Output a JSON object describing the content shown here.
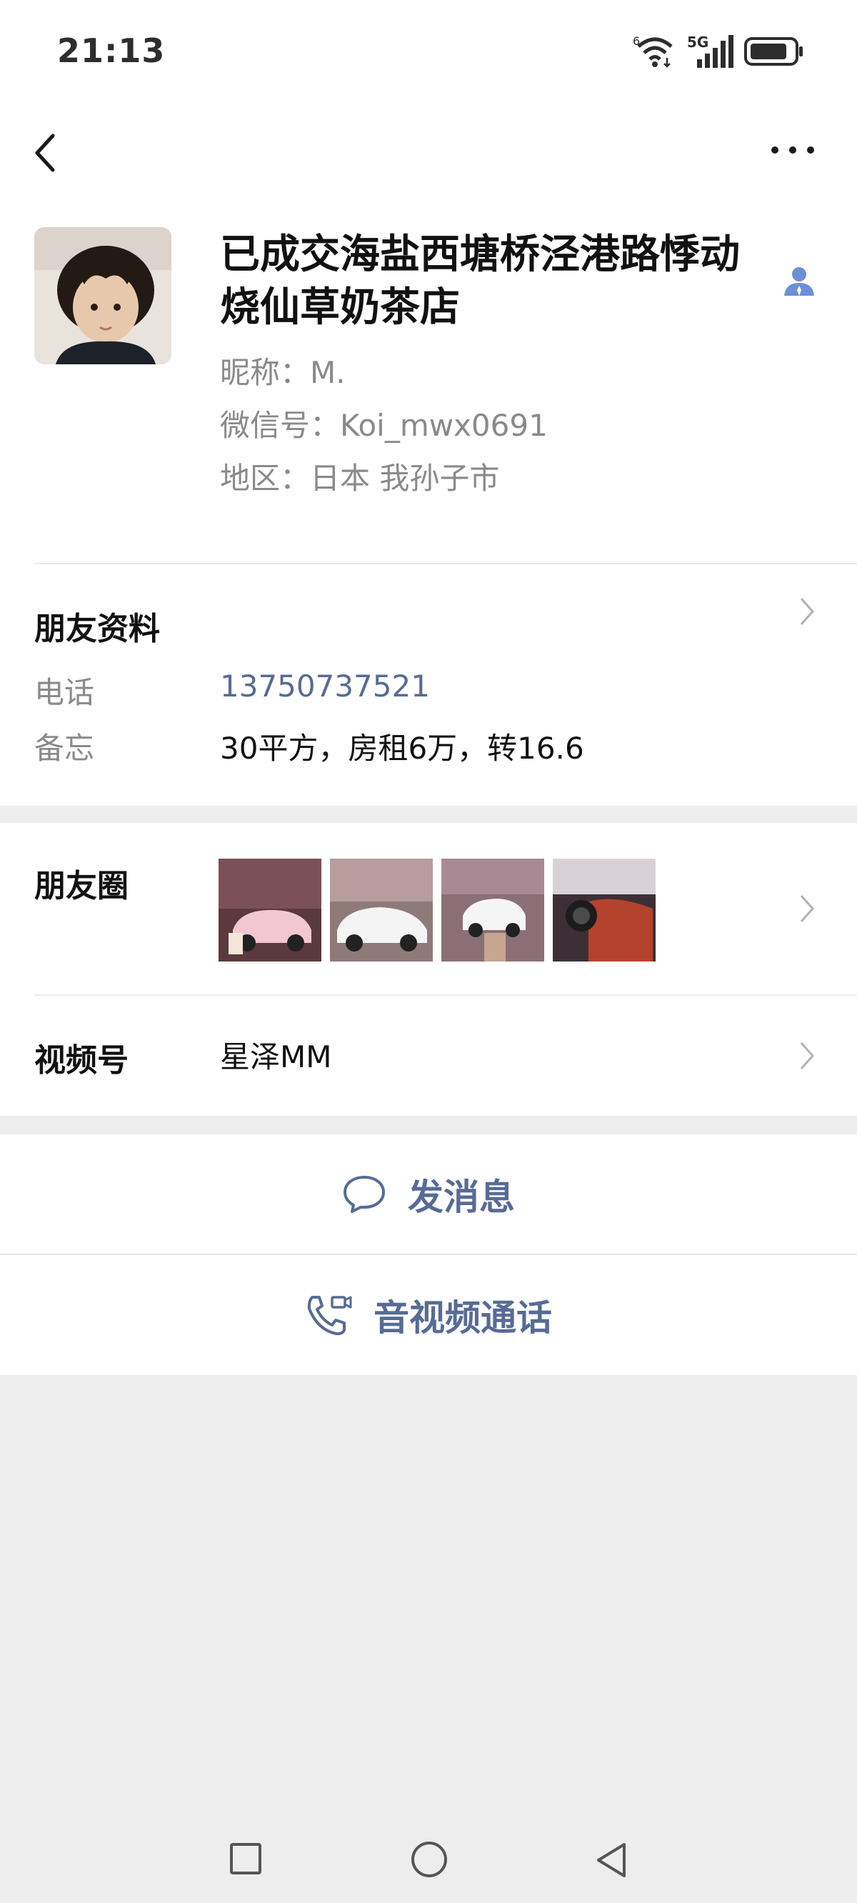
{
  "status_bar": {
    "time": "21:13",
    "wifi_badge": "6",
    "network": "5G",
    "icons": [
      "wifi-icon",
      "signal-icon",
      "battery-icon"
    ]
  },
  "nav": {
    "back_icon": "chevron-left-icon",
    "more_icon": "more-dots-icon"
  },
  "profile": {
    "name_line1": "已成交海盐西塘桥泾港路悸动",
    "name_line2": "烧仙草奶茶店",
    "nickname": "昵称：M.",
    "wechat_id": "微信号：Koi_mwx0691",
    "region": "地区：日本  我孙子市"
  },
  "friend_info": {
    "title": "朋友资料",
    "phone_label": "电话",
    "phone_value": "13750737521",
    "note_label": "备忘",
    "note_value": "30平方，房租6万，转16.6"
  },
  "moments": {
    "label": "朋友圈",
    "thumbnail_count": 4
  },
  "channels": {
    "label": "视频号",
    "value": "星泽MM"
  },
  "actions": {
    "message": "发消息",
    "call": "音视频通话"
  },
  "colors": {
    "link": "#576b95",
    "background": "#ededed",
    "card": "#ffffff"
  }
}
